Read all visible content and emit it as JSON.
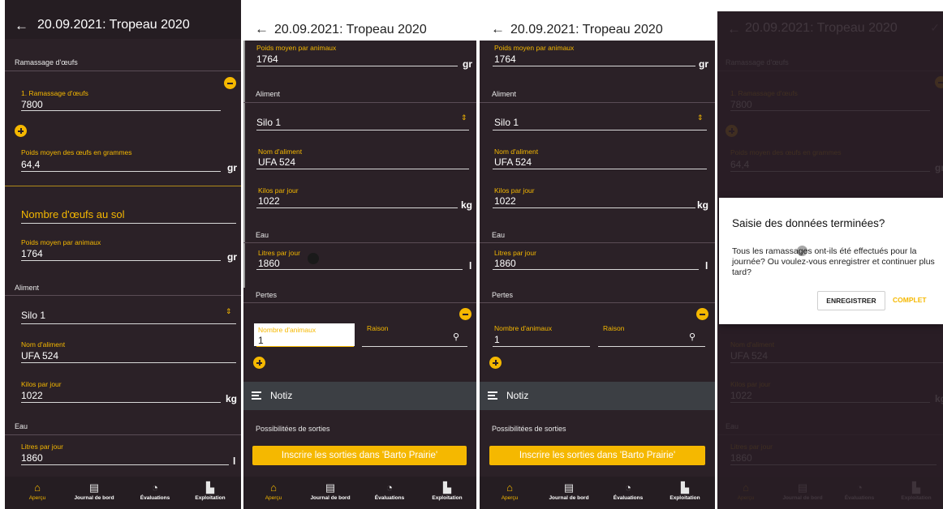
{
  "header": {
    "title": "20.09.2021: Tropeau 2020"
  },
  "sections": {
    "egg_collection": "Ramassage d'œufs",
    "feed": "Aliment",
    "water": "Eau",
    "losses": "Pertes",
    "exits": "Possibilitées de sorties"
  },
  "fields": {
    "collection1_label": "1. Ramassage d'œufs",
    "collection1_value": "7800",
    "egg_weight_label": "Poids moyen des œufs en grammes",
    "egg_weight_value": "64,4",
    "egg_weight_unit": "gr",
    "floor_eggs_placeholder": "Nombre d'œufs au sol",
    "animal_weight_label": "Poids moyen par animaux",
    "animal_weight_value": "1764",
    "animal_weight_unit": "gr",
    "silo_value": "Silo 1",
    "feed_name_label": "Nom d'aliment",
    "feed_name_value": "UFA 524",
    "kilos_label": "Kilos par jour",
    "kilos_value": "1022",
    "kilos_unit": "kg",
    "liters_label": "Litres par jour",
    "liters_value": "1860",
    "liters_unit": "l",
    "animals_count_label": "Nombre d'animaux",
    "animals_count_value": "1",
    "reason_label": "Raison"
  },
  "notes": {
    "label": "Notiz"
  },
  "exits_button": "Inscrire les sorties dans 'Barto Prairie'",
  "nav": {
    "overview": "Aperçu",
    "logbook": "Journal de bord",
    "evaluations": "Évaluations",
    "farm": "Exploitation"
  },
  "dialog": {
    "title": "Saisie des données terminées?",
    "body": "Tous les ramassages ont-ils été effectués pour la journée? Ou voulez-vous enregistrer et continuer plus tard?",
    "save": "ENREGISTRER",
    "complete": "COMPLET"
  },
  "colors": {
    "accent": "#f5b800",
    "background": "#2b2127",
    "notes_bar": "#3c3f44"
  },
  "icons": {
    "back": "arrow-left-icon",
    "search": "search-icon",
    "check": "check-icon"
  }
}
